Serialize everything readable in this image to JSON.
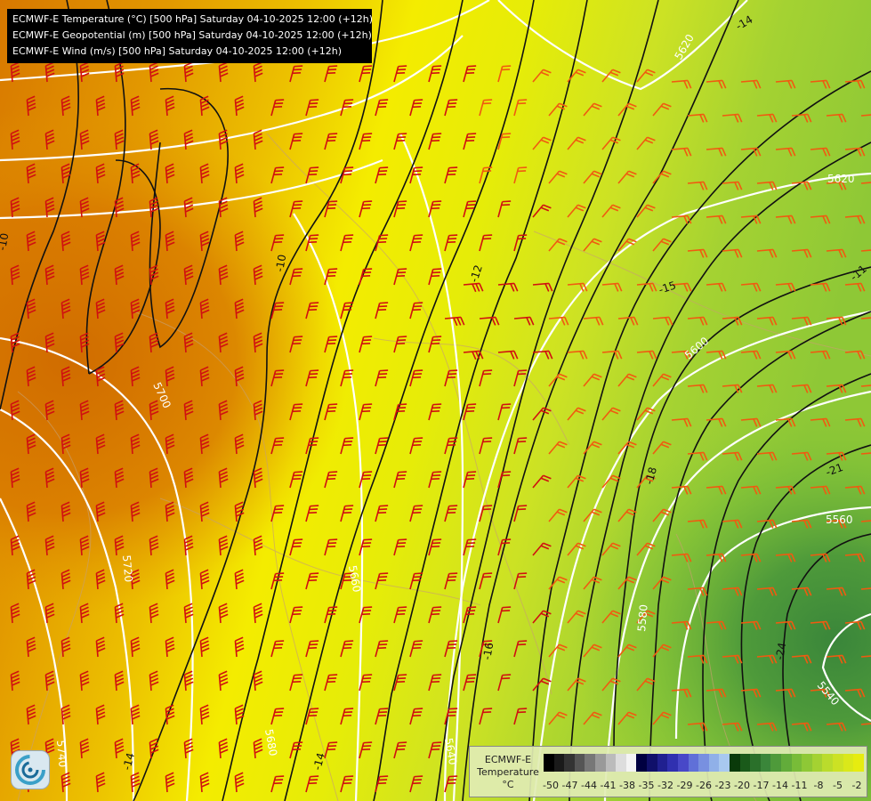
{
  "header": {
    "temperature_line": "ECMWF-E Temperature (°C) [500 hPa] Saturday 04-10-2025 12:00 (+12h)",
    "geopotential_line": "ECMWF-E Geopotential (m) [500 hPa] Saturday 04-10-2025 12:00 (+12h)",
    "wind_line": "ECMWF-E Wind (m/s) [500 hPa] Saturday 04-10-2025 12:00 (+12h)"
  },
  "legend": {
    "title_line1": "ECMWF-E",
    "title_line2": "Temperature",
    "unit": "°C",
    "ticks": [
      "-50",
      "-47",
      "-44",
      "-41",
      "-38",
      "-35",
      "-32",
      "-29",
      "-26",
      "-23",
      "-20",
      "-17",
      "-14",
      "-11",
      "-8",
      "-5",
      "-2"
    ],
    "colors": [
      "#000000",
      "#1a1a1a",
      "#333333",
      "#555555",
      "#777777",
      "#999999",
      "#bbbbbb",
      "#dddddd",
      "#f4f4f4",
      "#000040",
      "#10106a",
      "#202090",
      "#3030b0",
      "#4848c8",
      "#6070d8",
      "#7890e0",
      "#90b0e8",
      "#a8c8f0",
      "#0a3a0a",
      "#1a5a1a",
      "#2a702a",
      "#3a863a",
      "#4e9a3a",
      "#62ac3a",
      "#78bc38",
      "#8ec836",
      "#a4d232",
      "#badc2c",
      "#cce224",
      "#dae81a",
      "#e6ec10",
      "#eef004",
      "#f6f200",
      "#f0dc00",
      "#ecc600",
      "#e8b000",
      "#e09400",
      "#d87800",
      "#d05c00",
      "#c83c00",
      "#c01c00",
      "#b00000",
      "#a00040",
      "#a00080",
      "#a000b0",
      "#9000d0",
      "#8000e0",
      "#7000c8",
      "#6000a8"
    ]
  },
  "map": {
    "temperature_labels": [
      "-10",
      "-10",
      "-12",
      "-14",
      "-15",
      "-16",
      "-18",
      "-21",
      "-24",
      "-11",
      "-14",
      "-14"
    ],
    "geopotential_labels": [
      "5700",
      "5720",
      "5740",
      "5620",
      "5600",
      "5580",
      "5560",
      "5540",
      "5640",
      "5620",
      "5680",
      "5660"
    ]
  },
  "icons": {
    "logo": "meteo-swirl-logo"
  }
}
